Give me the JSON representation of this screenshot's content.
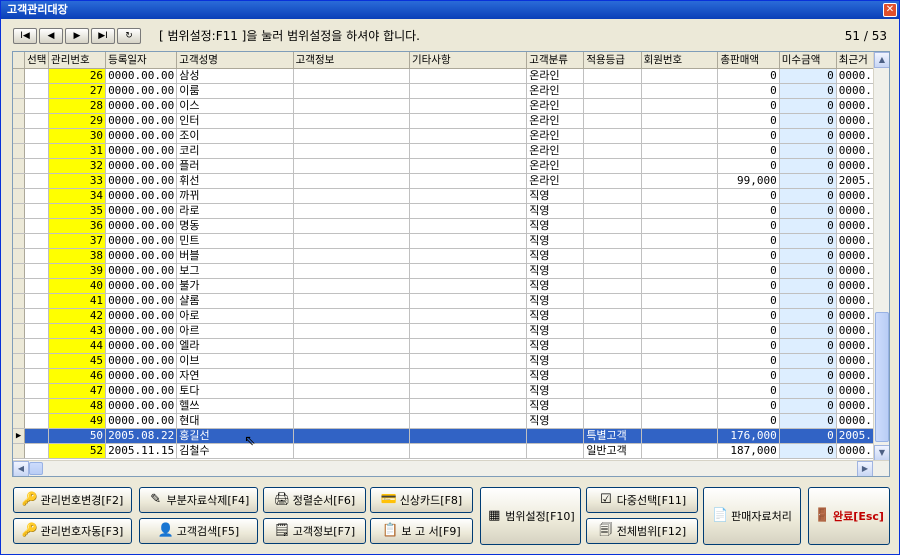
{
  "window": {
    "title": "고객관리대장",
    "close_label": "✕"
  },
  "nav": {
    "first": "I◀",
    "prev": "◀",
    "next": "▶",
    "last": "▶I",
    "refresh": "↻"
  },
  "hint": "[ 범위설정:F11 ]을 눌러 범위설정을 하셔야 합니다.",
  "counter": "51 / 53",
  "columns": [
    "선택",
    "관리번호",
    "등록일자",
    "고객성명",
    "고객정보",
    "기타사항",
    "고객분류",
    "적용등급",
    "회원번호",
    "총판매액",
    "미수금액",
    "최근거"
  ],
  "rows": [
    {
      "no": "26",
      "date": "0000.00.00",
      "name": "삼성",
      "cat": "온라인",
      "grade": "",
      "total": "0",
      "miss": "0",
      "recent": "0000."
    },
    {
      "no": "27",
      "date": "0000.00.00",
      "name": "이룸",
      "cat": "온라인",
      "grade": "",
      "total": "0",
      "miss": "0",
      "recent": "0000."
    },
    {
      "no": "28",
      "date": "0000.00.00",
      "name": "이스",
      "cat": "온라인",
      "grade": "",
      "total": "0",
      "miss": "0",
      "recent": "0000."
    },
    {
      "no": "29",
      "date": "0000.00.00",
      "name": "인터",
      "cat": "온라인",
      "grade": "",
      "total": "0",
      "miss": "0",
      "recent": "0000."
    },
    {
      "no": "30",
      "date": "0000.00.00",
      "name": "조이",
      "cat": "온라인",
      "grade": "",
      "total": "0",
      "miss": "0",
      "recent": "0000."
    },
    {
      "no": "31",
      "date": "0000.00.00",
      "name": "코리",
      "cat": "온라인",
      "grade": "",
      "total": "0",
      "miss": "0",
      "recent": "0000."
    },
    {
      "no": "32",
      "date": "0000.00.00",
      "name": "플러",
      "cat": "온라인",
      "grade": "",
      "total": "0",
      "miss": "0",
      "recent": "0000."
    },
    {
      "no": "33",
      "date": "0000.00.00",
      "name": "휘선",
      "cat": "온라인",
      "grade": "",
      "total": "99,000",
      "miss": "0",
      "recent": "2005."
    },
    {
      "no": "34",
      "date": "0000.00.00",
      "name": "까뀌",
      "cat": "직영",
      "grade": "",
      "total": "0",
      "miss": "0",
      "recent": "0000."
    },
    {
      "no": "35",
      "date": "0000.00.00",
      "name": "라로",
      "cat": "직영",
      "grade": "",
      "total": "0",
      "miss": "0",
      "recent": "0000."
    },
    {
      "no": "36",
      "date": "0000.00.00",
      "name": "명동",
      "cat": "직영",
      "grade": "",
      "total": "0",
      "miss": "0",
      "recent": "0000."
    },
    {
      "no": "37",
      "date": "0000.00.00",
      "name": "민트",
      "cat": "직영",
      "grade": "",
      "total": "0",
      "miss": "0",
      "recent": "0000."
    },
    {
      "no": "38",
      "date": "0000.00.00",
      "name": "버블",
      "cat": "직영",
      "grade": "",
      "total": "0",
      "miss": "0",
      "recent": "0000."
    },
    {
      "no": "39",
      "date": "0000.00.00",
      "name": "보그",
      "cat": "직영",
      "grade": "",
      "total": "0",
      "miss": "0",
      "recent": "0000."
    },
    {
      "no": "40",
      "date": "0000.00.00",
      "name": "불가",
      "cat": "직영",
      "grade": "",
      "total": "0",
      "miss": "0",
      "recent": "0000."
    },
    {
      "no": "41",
      "date": "0000.00.00",
      "name": "샬롬",
      "cat": "직영",
      "grade": "",
      "total": "0",
      "miss": "0",
      "recent": "0000."
    },
    {
      "no": "42",
      "date": "0000.00.00",
      "name": "아로",
      "cat": "직영",
      "grade": "",
      "total": "0",
      "miss": "0",
      "recent": "0000."
    },
    {
      "no": "43",
      "date": "0000.00.00",
      "name": "아르",
      "cat": "직영",
      "grade": "",
      "total": "0",
      "miss": "0",
      "recent": "0000."
    },
    {
      "no": "44",
      "date": "0000.00.00",
      "name": "엘라",
      "cat": "직영",
      "grade": "",
      "total": "0",
      "miss": "0",
      "recent": "0000."
    },
    {
      "no": "45",
      "date": "0000.00.00",
      "name": "이브",
      "cat": "직영",
      "grade": "",
      "total": "0",
      "miss": "0",
      "recent": "0000."
    },
    {
      "no": "46",
      "date": "0000.00.00",
      "name": "자연",
      "cat": "직영",
      "grade": "",
      "total": "0",
      "miss": "0",
      "recent": "0000."
    },
    {
      "no": "47",
      "date": "0000.00.00",
      "name": "토다",
      "cat": "직영",
      "grade": "",
      "total": "0",
      "miss": "0",
      "recent": "0000."
    },
    {
      "no": "48",
      "date": "0000.00.00",
      "name": "헬쓰",
      "cat": "직영",
      "grade": "",
      "total": "0",
      "miss": "0",
      "recent": "0000."
    },
    {
      "no": "49",
      "date": "0000.00.00",
      "name": "현대",
      "cat": "직영",
      "grade": "",
      "total": "0",
      "miss": "0",
      "recent": "0000."
    },
    {
      "no": "50",
      "date": "2005.08.22",
      "name": "홍길선",
      "cat": "",
      "grade": "특별고객",
      "total": "176,000",
      "miss": "0",
      "recent": "2005.",
      "selected": true
    },
    {
      "no": "52",
      "date": "2005.11.15",
      "name": "김철수",
      "cat": "",
      "grade": "일반고객",
      "total": "187,000",
      "miss": "0",
      "recent": "0000."
    }
  ],
  "buttons": {
    "mgmt_change": "관리번호변경[F2]",
    "partial_delete": "부분자료삭제[F4]",
    "sort_order": "정렬순서[F6]",
    "credit_card": "신상카드[F8]",
    "range_set": "범위설정[F10]",
    "multi_select": "다중선택[F11]",
    "sales_proc": "판매자료처리",
    "done": "완료[Esc]",
    "mgmt_auto": "관리번호자동[F3]",
    "customer_search": "고객검색[F5]",
    "customer_info": "고객정보[F7]",
    "report": "보 고 서[F9]",
    "all_range": "전체범위[F12]"
  },
  "colors": {
    "accent": "#3163c5",
    "highlight": "#ffff00",
    "miss_bg": "#ddeeff",
    "esc_text": "#c00000"
  }
}
